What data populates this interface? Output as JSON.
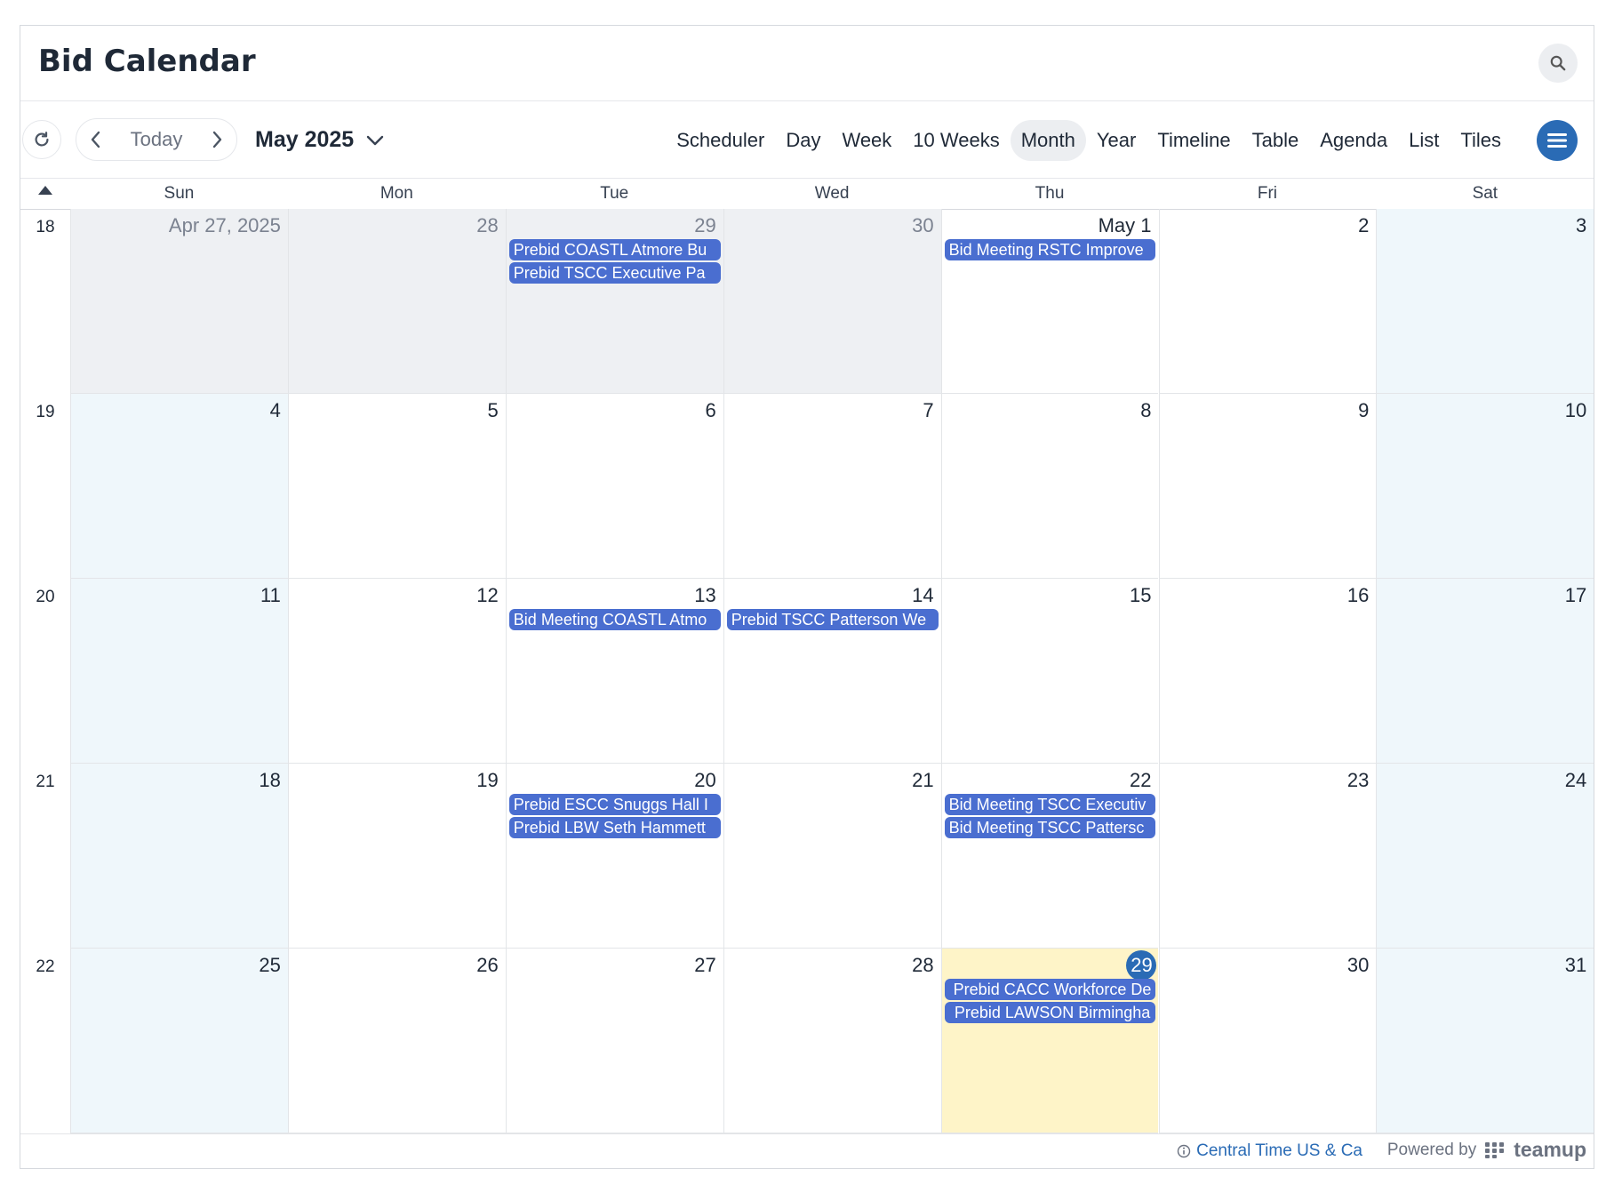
{
  "app": {
    "title": "Bid Calendar"
  },
  "toolbar": {
    "today_label": "Today",
    "month_label": "May 2025",
    "views": [
      {
        "label": "Scheduler",
        "active": false
      },
      {
        "label": "Day",
        "active": false
      },
      {
        "label": "Week",
        "active": false
      },
      {
        "label": "10 Weeks",
        "active": false
      },
      {
        "label": "Month",
        "active": true
      },
      {
        "label": "Year",
        "active": false
      },
      {
        "label": "Timeline",
        "active": false
      },
      {
        "label": "Table",
        "active": false
      },
      {
        "label": "Agenda",
        "active": false
      },
      {
        "label": "List",
        "active": false
      },
      {
        "label": "Tiles",
        "active": false
      }
    ]
  },
  "days_of_week": [
    "Sun",
    "Mon",
    "Tue",
    "Wed",
    "Thu",
    "Fri",
    "Sat"
  ],
  "weeks": [
    {
      "week_number": "18",
      "days": [
        {
          "label": "Apr 27, 2025",
          "other_month": true,
          "events": []
        },
        {
          "label": "28",
          "other_month": true,
          "events": []
        },
        {
          "label": "29",
          "other_month": true,
          "events": [
            "Prebid COASTL Atmore Bu",
            "Prebid TSCC Executive Pa"
          ]
        },
        {
          "label": "30",
          "other_month": true,
          "events": []
        },
        {
          "label": "May 1",
          "events": [
            "Bid Meeting RSTC Improve"
          ]
        },
        {
          "label": "2",
          "events": []
        },
        {
          "label": "3",
          "events": []
        }
      ]
    },
    {
      "week_number": "19",
      "days": [
        {
          "label": "4",
          "events": []
        },
        {
          "label": "5",
          "events": []
        },
        {
          "label": "6",
          "events": []
        },
        {
          "label": "7",
          "events": []
        },
        {
          "label": "8",
          "events": []
        },
        {
          "label": "9",
          "events": []
        },
        {
          "label": "10",
          "events": []
        }
      ]
    },
    {
      "week_number": "20",
      "days": [
        {
          "label": "11",
          "events": []
        },
        {
          "label": "12",
          "events": []
        },
        {
          "label": "13",
          "events": [
            "Bid Meeting COASTL Atmo"
          ]
        },
        {
          "label": "14",
          "events": [
            "Prebid TSCC Patterson We"
          ]
        },
        {
          "label": "15",
          "events": []
        },
        {
          "label": "16",
          "events": []
        },
        {
          "label": "17",
          "events": []
        }
      ]
    },
    {
      "week_number": "21",
      "days": [
        {
          "label": "18",
          "events": []
        },
        {
          "label": "19",
          "events": []
        },
        {
          "label": "20",
          "events": [
            "Prebid ESCC Snuggs Hall I",
            "Prebid LBW Seth Hammett"
          ]
        },
        {
          "label": "21",
          "events": []
        },
        {
          "label": "22",
          "events": [
            "Bid Meeting TSCC Executiv",
            "Bid Meeting TSCC Pattersc"
          ]
        },
        {
          "label": "23",
          "events": []
        },
        {
          "label": "24",
          "events": []
        }
      ]
    },
    {
      "week_number": "22",
      "days": [
        {
          "label": "25",
          "events": []
        },
        {
          "label": "26",
          "events": []
        },
        {
          "label": "27",
          "events": []
        },
        {
          "label": "28",
          "events": []
        },
        {
          "label": "29",
          "today": true,
          "events": [
            "Prebid CACC Workforce De",
            "Prebid LAWSON Birmingha"
          ]
        },
        {
          "label": "30",
          "events": []
        },
        {
          "label": "31",
          "events": []
        }
      ]
    }
  ],
  "footer": {
    "timezone": "Central Time US & Ca",
    "powered_by": "Powered by",
    "brand": "teamup"
  },
  "colors": {
    "accent": "#2a6bb5",
    "event": "#4a6ed0",
    "today_bg": "#fef4c8",
    "weekend_bg": "#eff7fb",
    "other_month_bg": "#eef0f3"
  }
}
